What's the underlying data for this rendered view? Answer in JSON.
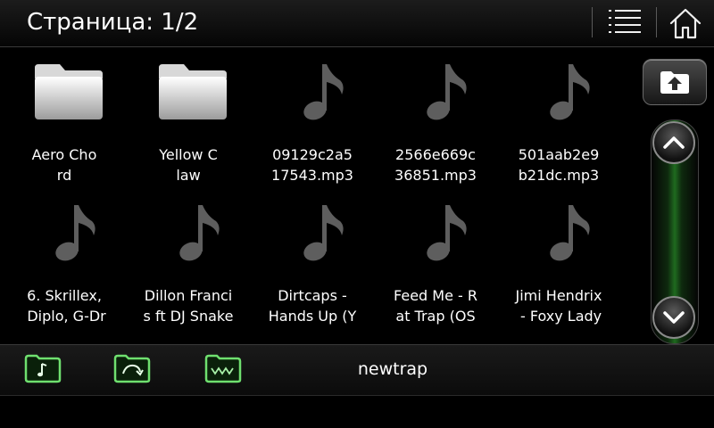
{
  "header": {
    "page_label": "Страница: 1/2",
    "menu_icon": "list-menu-icon",
    "home_icon": "home-icon"
  },
  "items": [
    {
      "name": "Aero Cho\nrd",
      "type": "folder"
    },
    {
      "name": "Yellow C\nlaw",
      "type": "folder"
    },
    {
      "name": "09129c2a5\n17543.mp3",
      "type": "music"
    },
    {
      "name": "2566e669c\n36851.mp3",
      "type": "music"
    },
    {
      "name": "501aab2e9\nb21dc.mp3",
      "type": "music"
    },
    {
      "name": "6. Skrillex,\n Diplo, G-Dr",
      "type": "music"
    },
    {
      "name": "Dillon Franci\ns ft DJ Snake",
      "type": "music"
    },
    {
      "name": "Dirtcaps -\nHands Up (Y",
      "type": "music"
    },
    {
      "name": "Feed Me - R\nat Trap (OS",
      "type": "music"
    },
    {
      "name": "Jimi Hendrix\n - Foxy Lady",
      "type": "music"
    }
  ],
  "sidebar": {
    "up_folder_icon": "folder-up-icon",
    "scroll_up_icon": "chevron-up-icon",
    "scroll_down_icon": "chevron-down-icon"
  },
  "footer": {
    "current_folder": "newtrap",
    "buttons": [
      "music-folder-icon",
      "repeat-folder-icon",
      "wave-folder-icon"
    ]
  },
  "colors": {
    "accent_green": "#5fd35f",
    "background": "#000000"
  }
}
